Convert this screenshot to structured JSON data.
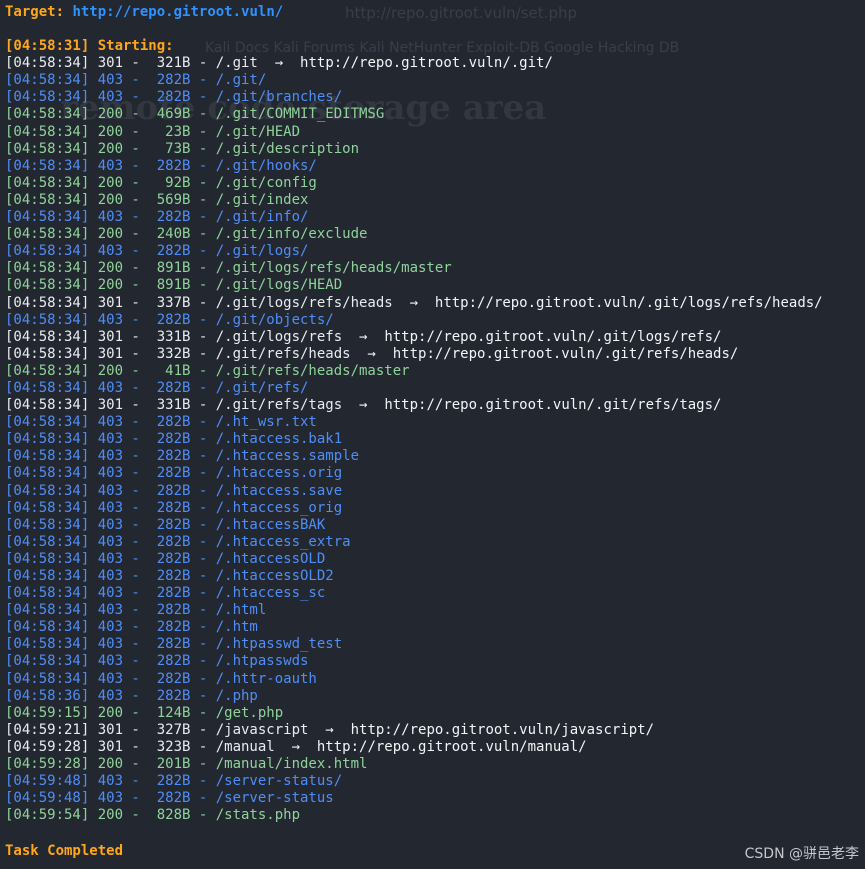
{
  "ghost": {
    "url": "http://repo.gitroot.vuln/set.php",
    "bookmarks": "Kali Docs   Kali Forums   Kali NetHunter   Exploit-DB   Google Hacking DB",
    "title": "remote code storage area"
  },
  "header": {
    "target_label": "Target:",
    "target_url": "http://repo.gitroot.vuln/"
  },
  "start_line": "[04:58:31] Starting:",
  "entries": [
    {
      "time": "[04:58:34]",
      "status": "301",
      "size": "321B",
      "path": "/.git",
      "redirect": "http://repo.gitroot.vuln/.git/"
    },
    {
      "time": "[04:58:34]",
      "status": "403",
      "size": "282B",
      "path": "/.git/",
      "redirect": ""
    },
    {
      "time": "[04:58:34]",
      "status": "403",
      "size": "282B",
      "path": "/.git/branches/",
      "redirect": ""
    },
    {
      "time": "[04:58:34]",
      "status": "200",
      "size": "469B",
      "path": "/.git/COMMIT_EDITMSG",
      "redirect": ""
    },
    {
      "time": "[04:58:34]",
      "status": "200",
      "size": "23B",
      "path": "/.git/HEAD",
      "redirect": ""
    },
    {
      "time": "[04:58:34]",
      "status": "200",
      "size": "73B",
      "path": "/.git/description",
      "redirect": ""
    },
    {
      "time": "[04:58:34]",
      "status": "403",
      "size": "282B",
      "path": "/.git/hooks/",
      "redirect": ""
    },
    {
      "time": "[04:58:34]",
      "status": "200",
      "size": "92B",
      "path": "/.git/config",
      "redirect": ""
    },
    {
      "time": "[04:58:34]",
      "status": "200",
      "size": "569B",
      "path": "/.git/index",
      "redirect": ""
    },
    {
      "time": "[04:58:34]",
      "status": "403",
      "size": "282B",
      "path": "/.git/info/",
      "redirect": ""
    },
    {
      "time": "[04:58:34]",
      "status": "200",
      "size": "240B",
      "path": "/.git/info/exclude",
      "redirect": ""
    },
    {
      "time": "[04:58:34]",
      "status": "403",
      "size": "282B",
      "path": "/.git/logs/",
      "redirect": ""
    },
    {
      "time": "[04:58:34]",
      "status": "200",
      "size": "891B",
      "path": "/.git/logs/refs/heads/master",
      "redirect": ""
    },
    {
      "time": "[04:58:34]",
      "status": "200",
      "size": "891B",
      "path": "/.git/logs/HEAD",
      "redirect": ""
    },
    {
      "time": "[04:58:34]",
      "status": "301",
      "size": "337B",
      "path": "/.git/logs/refs/heads",
      "redirect": "http://repo.gitroot.vuln/.git/logs/refs/heads/"
    },
    {
      "time": "[04:58:34]",
      "status": "403",
      "size": "282B",
      "path": "/.git/objects/",
      "redirect": ""
    },
    {
      "time": "[04:58:34]",
      "status": "301",
      "size": "331B",
      "path": "/.git/logs/refs",
      "redirect": "http://repo.gitroot.vuln/.git/logs/refs/"
    },
    {
      "time": "[04:58:34]",
      "status": "301",
      "size": "332B",
      "path": "/.git/refs/heads",
      "redirect": "http://repo.gitroot.vuln/.git/refs/heads/"
    },
    {
      "time": "[04:58:34]",
      "status": "200",
      "size": "41B",
      "path": "/.git/refs/heads/master",
      "redirect": ""
    },
    {
      "time": "[04:58:34]",
      "status": "403",
      "size": "282B",
      "path": "/.git/refs/",
      "redirect": ""
    },
    {
      "time": "[04:58:34]",
      "status": "301",
      "size": "331B",
      "path": "/.git/refs/tags",
      "redirect": "http://repo.gitroot.vuln/.git/refs/tags/"
    },
    {
      "time": "[04:58:34]",
      "status": "403",
      "size": "282B",
      "path": "/.ht_wsr.txt",
      "redirect": ""
    },
    {
      "time": "[04:58:34]",
      "status": "403",
      "size": "282B",
      "path": "/.htaccess.bak1",
      "redirect": ""
    },
    {
      "time": "[04:58:34]",
      "status": "403",
      "size": "282B",
      "path": "/.htaccess.sample",
      "redirect": ""
    },
    {
      "time": "[04:58:34]",
      "status": "403",
      "size": "282B",
      "path": "/.htaccess.orig",
      "redirect": ""
    },
    {
      "time": "[04:58:34]",
      "status": "403",
      "size": "282B",
      "path": "/.htaccess.save",
      "redirect": ""
    },
    {
      "time": "[04:58:34]",
      "status": "403",
      "size": "282B",
      "path": "/.htaccess_orig",
      "redirect": ""
    },
    {
      "time": "[04:58:34]",
      "status": "403",
      "size": "282B",
      "path": "/.htaccessBAK",
      "redirect": ""
    },
    {
      "time": "[04:58:34]",
      "status": "403",
      "size": "282B",
      "path": "/.htaccess_extra",
      "redirect": ""
    },
    {
      "time": "[04:58:34]",
      "status": "403",
      "size": "282B",
      "path": "/.htaccessOLD",
      "redirect": ""
    },
    {
      "time": "[04:58:34]",
      "status": "403",
      "size": "282B",
      "path": "/.htaccessOLD2",
      "redirect": ""
    },
    {
      "time": "[04:58:34]",
      "status": "403",
      "size": "282B",
      "path": "/.htaccess_sc",
      "redirect": ""
    },
    {
      "time": "[04:58:34]",
      "status": "403",
      "size": "282B",
      "path": "/.html",
      "redirect": ""
    },
    {
      "time": "[04:58:34]",
      "status": "403",
      "size": "282B",
      "path": "/.htm",
      "redirect": ""
    },
    {
      "time": "[04:58:34]",
      "status": "403",
      "size": "282B",
      "path": "/.htpasswd_test",
      "redirect": ""
    },
    {
      "time": "[04:58:34]",
      "status": "403",
      "size": "282B",
      "path": "/.htpasswds",
      "redirect": ""
    },
    {
      "time": "[04:58:34]",
      "status": "403",
      "size": "282B",
      "path": "/.httr-oauth",
      "redirect": ""
    },
    {
      "time": "[04:58:36]",
      "status": "403",
      "size": "282B",
      "path": "/.php",
      "redirect": ""
    },
    {
      "time": "[04:59:15]",
      "status": "200",
      "size": "124B",
      "path": "/get.php",
      "redirect": ""
    },
    {
      "time": "[04:59:21]",
      "status": "301",
      "size": "327B",
      "path": "/javascript",
      "redirect": "http://repo.gitroot.vuln/javascript/"
    },
    {
      "time": "[04:59:28]",
      "status": "301",
      "size": "323B",
      "path": "/manual",
      "redirect": "http://repo.gitroot.vuln/manual/"
    },
    {
      "time": "[04:59:28]",
      "status": "200",
      "size": "201B",
      "path": "/manual/index.html",
      "redirect": ""
    },
    {
      "time": "[04:59:48]",
      "status": "403",
      "size": "282B",
      "path": "/server-status/",
      "redirect": ""
    },
    {
      "time": "[04:59:48]",
      "status": "403",
      "size": "282B",
      "path": "/server-status",
      "redirect": ""
    },
    {
      "time": "[04:59:54]",
      "status": "200",
      "size": "828B",
      "path": "/stats.php",
      "redirect": ""
    }
  ],
  "footer": "Task Completed",
  "watermark": "CSDN @骈邑老李",
  "colors": {
    "s200": "#8fd39a",
    "s301": "#e8ecf1",
    "s403": "#4f8ef7",
    "accent": "#ffa71a",
    "url": "#2f93ff"
  }
}
